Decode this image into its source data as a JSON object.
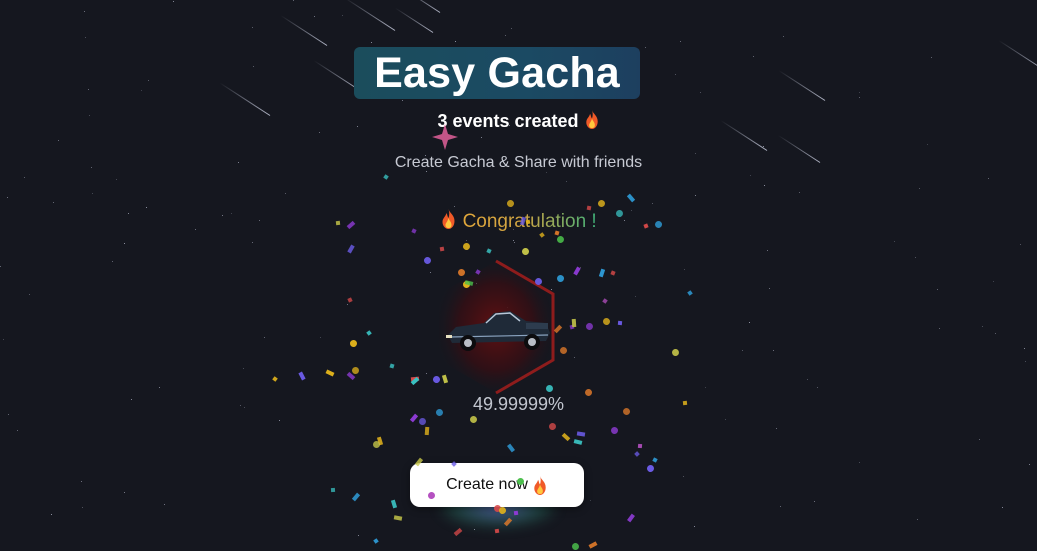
{
  "app": {
    "title": "Easy Gacha",
    "events_text": "3 events created",
    "subtitle": "Create Gacha & Share with friends"
  },
  "result": {
    "congrats_text": "Congratulation !",
    "item_image": "classic-convertible-car",
    "percent_text": "49.99999%"
  },
  "actions": {
    "create_label": "Create now"
  },
  "icons": {
    "fire": "fire-icon",
    "star": "sparkle-star-icon"
  },
  "colors": {
    "background": "#15171f",
    "title_bg": "#1b4d5c",
    "congrats_gold": "#e1a73a",
    "congrats_green": "#3fb27a",
    "hex_red": "#8e1c1c",
    "button_bg": "#ffffff"
  }
}
